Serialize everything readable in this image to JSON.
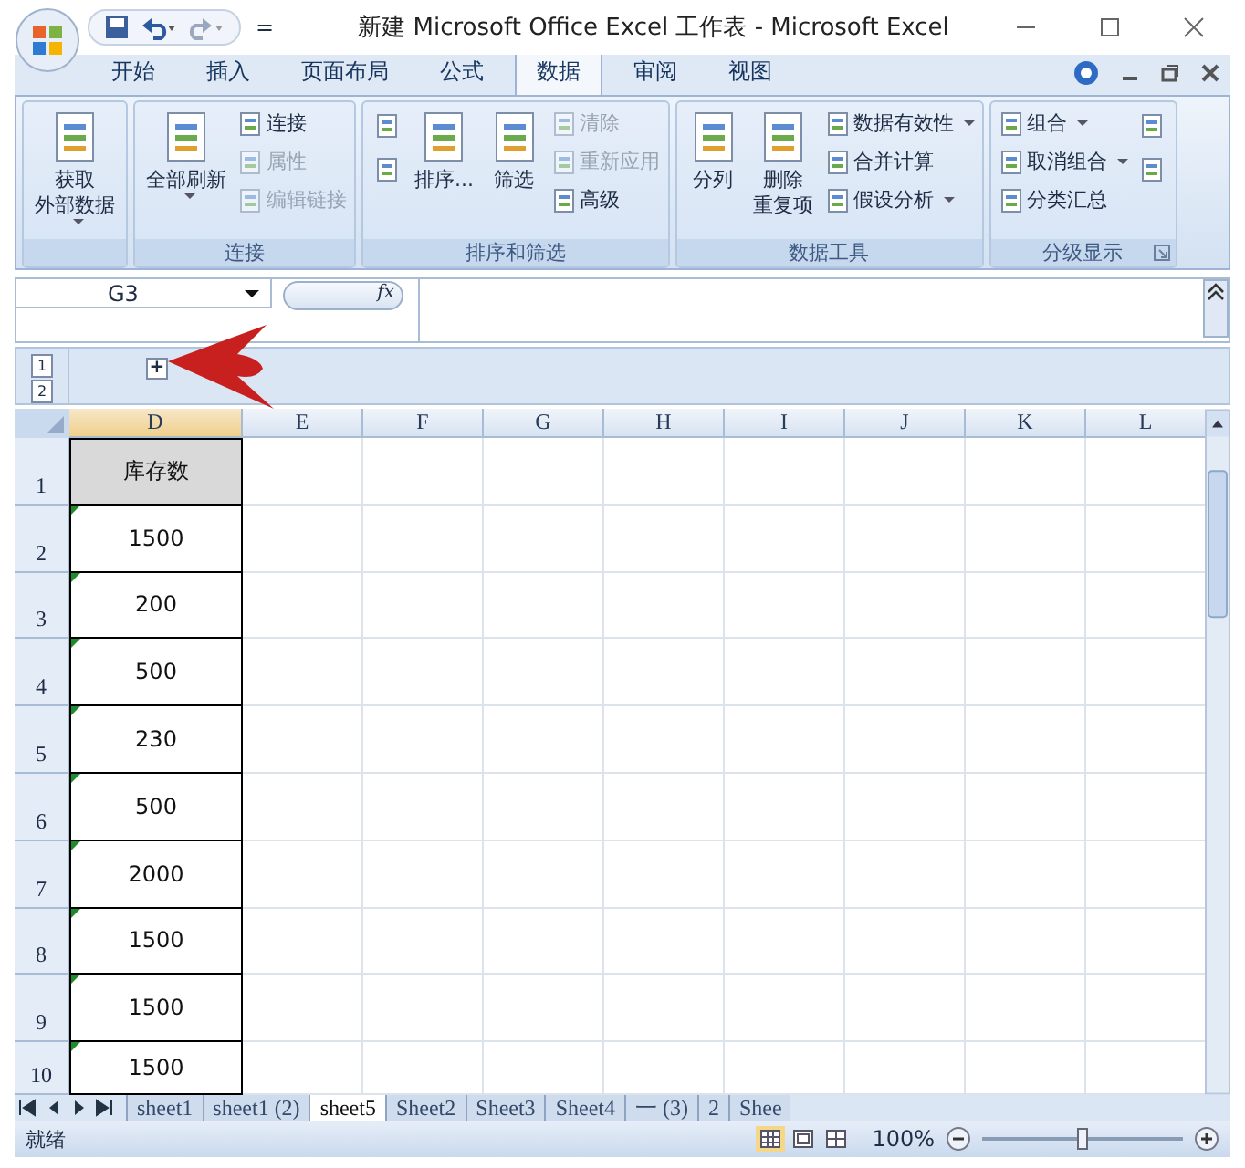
{
  "window": {
    "title": "新建 Microsoft Office Excel 工作表 - Microsoft Excel",
    "quick_access_more": "="
  },
  "tabs": [
    {
      "label": "开始",
      "selected": false
    },
    {
      "label": "插入",
      "selected": false
    },
    {
      "label": "页面布局",
      "selected": false
    },
    {
      "label": "公式",
      "selected": false
    },
    {
      "label": "数据",
      "selected": true
    },
    {
      "label": "审阅",
      "selected": false
    },
    {
      "label": "视图",
      "selected": false
    }
  ],
  "ribbon_groups": [
    {
      "columns": [
        [
          {
            "kind": "large",
            "lines": [
              "获取",
              "外部数据"
            ],
            "disabled": false,
            "dropdown": true
          }
        ]
      ]
    },
    {
      "label": "连接",
      "columns": [
        [
          {
            "kind": "large",
            "lines": [
              "全部刷新"
            ],
            "disabled": false,
            "dropdown": true
          }
        ],
        [
          {
            "kind": "small",
            "label": "连接",
            "disabled": false,
            "dropdown": false
          },
          {
            "kind": "small",
            "label": "属性",
            "disabled": true,
            "dropdown": false
          },
          {
            "kind": "small",
            "label": "编辑链接",
            "disabled": true,
            "dropdown": false
          }
        ]
      ]
    },
    {
      "label": "排序和筛选",
      "columns": [
        [
          {
            "kind": "icon",
            "disabled": false,
            "dropdown": false
          },
          {
            "kind": "icon",
            "disabled": false,
            "dropdown": false
          }
        ],
        [
          {
            "kind": "large",
            "lines": [
              "排序..."
            ],
            "disabled": false,
            "dropdown": false
          }
        ],
        [
          {
            "kind": "large",
            "lines": [
              "筛选"
            ],
            "disabled": false,
            "dropdown": false
          }
        ],
        [
          {
            "kind": "small",
            "label": "清除",
            "disabled": true,
            "dropdown": false
          },
          {
            "kind": "small",
            "label": "重新应用",
            "disabled": true,
            "dropdown": false
          },
          {
            "kind": "small",
            "label": "高级",
            "disabled": false,
            "dropdown": false
          }
        ]
      ]
    },
    {
      "label": "数据工具",
      "columns": [
        [
          {
            "kind": "large",
            "lines": [
              "分列"
            ],
            "disabled": false,
            "dropdown": false
          }
        ],
        [
          {
            "kind": "large",
            "lines": [
              "删除",
              "重复项"
            ],
            "disabled": false,
            "dropdown": false
          }
        ],
        [
          {
            "kind": "small",
            "label": "数据有效性",
            "disabled": false,
            "dropdown": true
          },
          {
            "kind": "small",
            "label": "合并计算",
            "disabled": false,
            "dropdown": false
          },
          {
            "kind": "small",
            "label": "假设分析",
            "disabled": false,
            "dropdown": true
          }
        ]
      ]
    },
    {
      "label": "分级显示",
      "launcher": true,
      "columns": [
        [
          {
            "kind": "small",
            "label": "组合",
            "disabled": false,
            "dropdown": true
          },
          {
            "kind": "small",
            "label": "取消组合",
            "disabled": false,
            "dropdown": true
          },
          {
            "kind": "small",
            "label": "分类汇总",
            "disabled": false,
            "dropdown": false
          }
        ],
        [
          {
            "kind": "icon",
            "disabled": false,
            "dropdown": false
          },
          {
            "kind": "icon",
            "disabled": false,
            "dropdown": false
          }
        ]
      ]
    }
  ],
  "formula_bar": {
    "name_box": "G3",
    "fx": "fx"
  },
  "outline": {
    "levels": [
      "1",
      "2"
    ],
    "expand": "+"
  },
  "sheet": {
    "columns": [
      "D",
      "E",
      "F",
      "G",
      "H",
      "I",
      "J",
      "K",
      "L"
    ],
    "rows": [
      {
        "number": "1",
        "cell": "库存数",
        "header": true,
        "warning": false
      },
      {
        "number": "2",
        "cell": "1500",
        "header": false,
        "warning": true
      },
      {
        "number": "3",
        "cell": "200",
        "header": false,
        "warning": true
      },
      {
        "number": "4",
        "cell": "500",
        "header": false,
        "warning": true
      },
      {
        "number": "5",
        "cell": "230",
        "header": false,
        "warning": true
      },
      {
        "number": "6",
        "cell": "500",
        "header": false,
        "warning": true
      },
      {
        "number": "7",
        "cell": "2000",
        "header": false,
        "warning": true
      },
      {
        "number": "8",
        "cell": "1500",
        "header": false,
        "warning": true
      },
      {
        "number": "9",
        "cell": "1500",
        "header": false,
        "warning": true
      },
      {
        "number": "10",
        "cell": "1500",
        "header": false,
        "warning": true
      }
    ]
  },
  "sheet_tabs": [
    {
      "label": "sheet1",
      "selected": false
    },
    {
      "label": "sheet1 (2)",
      "selected": false
    },
    {
      "label": "sheet5",
      "selected": true
    },
    {
      "label": "Sheet2",
      "selected": false
    },
    {
      "label": "Sheet3",
      "selected": false
    },
    {
      "label": "Sheet4",
      "selected": false
    },
    {
      "label": "一 (3)",
      "selected": false
    },
    {
      "label": "2",
      "selected": false
    },
    {
      "label": "Shee",
      "selected": false
    }
  ],
  "status_bar": {
    "status": "就绪",
    "views": [
      {
        "selected": true
      },
      {
        "selected": false
      },
      {
        "selected": false
      }
    ],
    "zoom": "100%",
    "zoom_level": {
      "level": 0.5
    }
  }
}
